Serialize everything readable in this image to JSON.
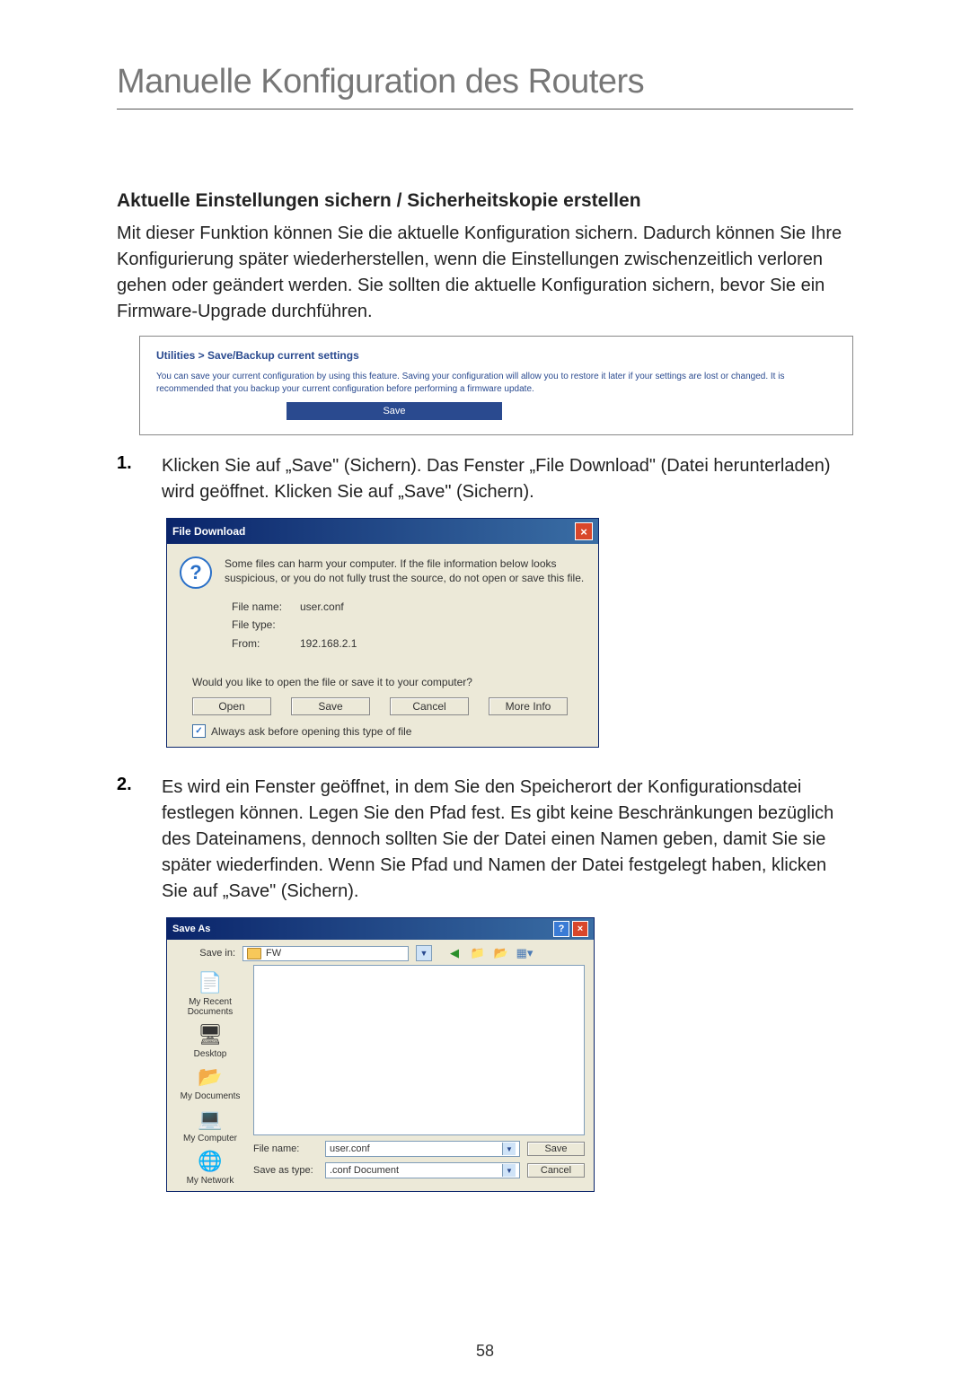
{
  "title": "Manuelle Konfiguration des Routers",
  "section_heading": "Aktuelle Einstellungen sichern / Sicherheitskopie erstellen",
  "intro": "Mit dieser Funktion können Sie die aktuelle Konfiguration sichern. Dadurch können Sie Ihre Konfigurierung später wiederherstellen, wenn die Einstellungen zwischenzeitlich verloren gehen oder geändert werden. Sie sollten die aktuelle Konfiguration sichern, bevor Sie ein Firmware-Upgrade durchführen.",
  "util_panel": {
    "title": "Utilities > Save/Backup current settings",
    "desc": "You can save your current configuration by using this feature. Saving your configuration will allow you to restore it later if your settings are lost or changed. It is recommended that you backup your current configuration before performing a firmware update.",
    "save_label": "Save"
  },
  "steps": [
    {
      "num": "1.",
      "text": "Klicken Sie auf „Save\" (Sichern). Das Fenster „File Download\" (Datei herunterladen) wird geöffnet. Klicken Sie auf „Save\" (Sichern)."
    },
    {
      "num": "2.",
      "text": "Es wird ein Fenster geöffnet, in dem Sie den Speicherort der Konfigurationsdatei festlegen können. Legen Sie den Pfad fest. Es gibt keine Beschränkungen bezüglich des Dateinamens, dennoch sollten Sie der Datei einen Namen geben, damit Sie sie später wiederfinden. Wenn Sie Pfad und Namen der Datei festgelegt haben, klicken Sie auf „Save\" (Sichern)."
    }
  ],
  "file_download": {
    "title": "File Download",
    "warning": "Some files can harm your computer. If the file information below looks suspicious, or you do not fully trust the source, do not open or save this file.",
    "fields": {
      "filename_label": "File name:",
      "filename_value": "user.conf",
      "filetype_label": "File type:",
      "filetype_value": "",
      "from_label": "From:",
      "from_value": "192.168.2.1"
    },
    "question": "Would you like to open the file or save it to your computer?",
    "buttons": {
      "open": "Open",
      "save": "Save",
      "cancel": "Cancel",
      "more": "More Info"
    },
    "checkbox_label": "Always ask before opening this type of file"
  },
  "save_as": {
    "title": "Save As",
    "save_in_label": "Save in:",
    "folder": "FW",
    "places": [
      {
        "icon": "📄",
        "label": "My Recent Documents"
      },
      {
        "icon": "🖥",
        "label": "Desktop"
      },
      {
        "icon": "📂",
        "label": "My Documents"
      },
      {
        "icon": "💻",
        "label": "My Computer"
      },
      {
        "icon": "🌐",
        "label": "My Network"
      }
    ],
    "filename_label": "File name:",
    "filename_value": "user.conf",
    "saveastype_label": "Save as type:",
    "saveastype_value": ".conf Document",
    "save_btn": "Save",
    "cancel_btn": "Cancel"
  },
  "page_number": "58"
}
